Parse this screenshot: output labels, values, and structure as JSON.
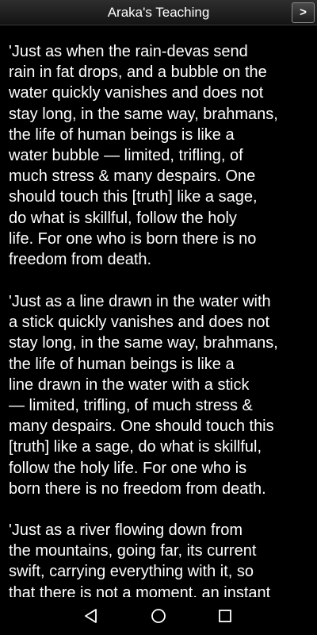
{
  "header": {
    "title": "Araka's Teaching",
    "next_label": ">"
  },
  "content": {
    "paragraphs": [
      "'Just as when the rain-devas send\nrain in fat drops, and a bubble on the\nwater quickly vanishes and does not\nstay long, in the same way, brahmans,\nthe life of human beings is like a\nwater bubble — limited, trifling, of\nmuch stress & many despairs. One\nshould touch this [truth] like a sage,\ndo what is skillful, follow the holy\nlife. For one who is born there is no\nfreedom from death.",
      "'Just as a line drawn in the water with\na stick quickly vanishes and does not\nstay long, in the same way, brahmans,\nthe life of human beings is like a\nline drawn in the water with a stick\n— limited, trifling, of much stress &\nmany despairs. One should touch this\n[truth] like a sage, do what is skillful,\nfollow the holy life. For one who is\nborn there is no freedom from death.",
      "'Just as a river flowing down from\nthe mountains, going far, its current\nswift, carrying everything with it, so\nthat there is not a moment, an instant"
    ]
  },
  "navbar": {
    "icons": [
      "back-triangle-icon",
      "home-circle-icon",
      "recent-apps-square-icon"
    ]
  },
  "colors": {
    "background": "#000000",
    "text": "#ffffff",
    "titlebar": "#1e1e1e"
  }
}
